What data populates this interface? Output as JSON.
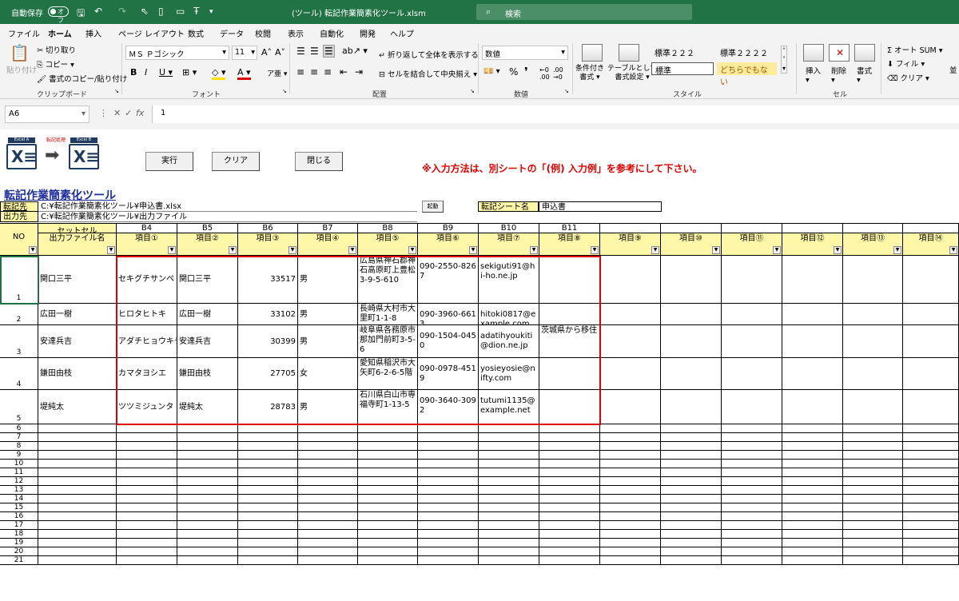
{
  "titlebar": {
    "autosave": "自動保存",
    "toggle": "オフ",
    "filename": "(ツール) 転記作業簡素化ツール.xlsm",
    "search": "検索"
  },
  "menu": [
    "ファイル",
    "ホーム",
    "挿入",
    "ページ レイアウト",
    "数式",
    "データ",
    "校閲",
    "表示",
    "自動化",
    "開発",
    "ヘルプ"
  ],
  "ribbon": {
    "clipboard": {
      "paste": "貼り付け",
      "cut": "切り取り",
      "copy": "コピー",
      "format_painter": "書式のコピー/貼り付け",
      "label": "クリップボード"
    },
    "font": {
      "name": "ＭＳ Ｐゴシック",
      "size": "11",
      "label": "フォント"
    },
    "alignment": {
      "wrap": "折り返して全体を表示する",
      "merge": "セルを結合して中央揃え",
      "label": "配置"
    },
    "number": {
      "format": "数値",
      "label": "数値"
    },
    "styles": {
      "conditional": "条件付き",
      "conditional2": "書式",
      "table": "テーブルとして",
      "table2": "書式設定",
      "s1": "標準２２２",
      "s2": "標準２２２２",
      "s3": "標準",
      "s4": "どちらでもない",
      "label": "スタイル"
    },
    "cells": {
      "insert": "挿入",
      "delete": "削除",
      "format": "書式",
      "label": "セル"
    },
    "editing": {
      "autosum": "オート SUM",
      "fill": "フィル",
      "clear": "クリア",
      "extra": "並"
    }
  },
  "formula": {
    "namebox": "A6",
    "fx": "fx",
    "value": "1"
  },
  "sheet": {
    "logo_left": "Excel A",
    "logo_mid": "転記処理",
    "logo_right": "Excel B",
    "btn_run": "実行",
    "btn_clear": "クリア",
    "btn_close": "閉じる",
    "note": "※入力方法は、別シートの「(例) 入力例」を参考にして下さい。",
    "tool_title": "転記作業簡素化ツール",
    "src_label": "転記先",
    "src_path": "C:¥転記作業簡素化ツール¥申込書.xlsx",
    "out_label": "出力先",
    "out_path": "C:¥転記作業簡素化ツール¥出力ファイル",
    "start_btn": "起動",
    "sheet_label": "転記シート名",
    "sheet_value": "申込書",
    "no_header": "NO",
    "set_cell": "セットセル",
    "out_name": "出力ファイル名",
    "cell_refs": [
      "B4",
      "B5",
      "B6",
      "B7",
      "B8",
      "B9",
      "B10",
      "B11"
    ],
    "items": [
      "項目①",
      "項目②",
      "項目③",
      "項目④",
      "項目⑤",
      "項目⑥",
      "項目⑦",
      "項目⑧",
      "項目⑨",
      "項目⑩",
      "項目⑪",
      "項目⑫",
      "項目⑬",
      "項目⑭"
    ],
    "rows": [
      {
        "no": "1",
        "name": "関口三平",
        "c": [
          "セキグチサンペ",
          "関口三平",
          "33517",
          "男",
          "広島県神石郡神石高原町上豊松3-9-5-610",
          "090-2550-8267",
          "sekiguti91@hi-ho.ne.jp",
          ""
        ]
      },
      {
        "no": "2",
        "name": "広田一樹",
        "c": [
          "ヒロタヒトキ",
          "広田一樹",
          "33102",
          "男",
          "長崎県大村市大里町1-1-8",
          "090-3960-6613",
          "hitoki0817@example.com",
          ""
        ]
      },
      {
        "no": "3",
        "name": "安達兵吉",
        "c": [
          "アダチヒョウキチ",
          "安達兵吉",
          "30399",
          "男",
          "岐阜県各務原市那加門前町3-5-6",
          "090-1504-0450",
          "adatihyoukiti@dion.ne.jp",
          "茨城県から移住"
        ]
      },
      {
        "no": "4",
        "name": "鎌田由枝",
        "c": [
          "カマタヨシエ",
          "鎌田由枝",
          "27705",
          "女",
          "愛知県稲沢市大矢町6-2-6-5階",
          "090-0978-4519",
          "yosieyosie@nifty.com",
          ""
        ]
      },
      {
        "no": "5",
        "name": "堤純太",
        "c": [
          "ツツミジュンタ",
          "堤純太",
          "28783",
          "男",
          "石川県白山市専福寺町1-13-5",
          "090-3640-3092",
          "tutumi1135@example.net",
          ""
        ]
      }
    ],
    "empty_rows": [
      "6",
      "7",
      "8",
      "9",
      "10",
      "11",
      "12",
      "13",
      "14",
      "15",
      "16",
      "17",
      "18",
      "19",
      "20",
      "21"
    ]
  },
  "colors": {
    "excel_green": "#217346",
    "header_yellow": "#fff7a8",
    "note_red": "#e00000",
    "title_blue": "#1d2f9e"
  }
}
